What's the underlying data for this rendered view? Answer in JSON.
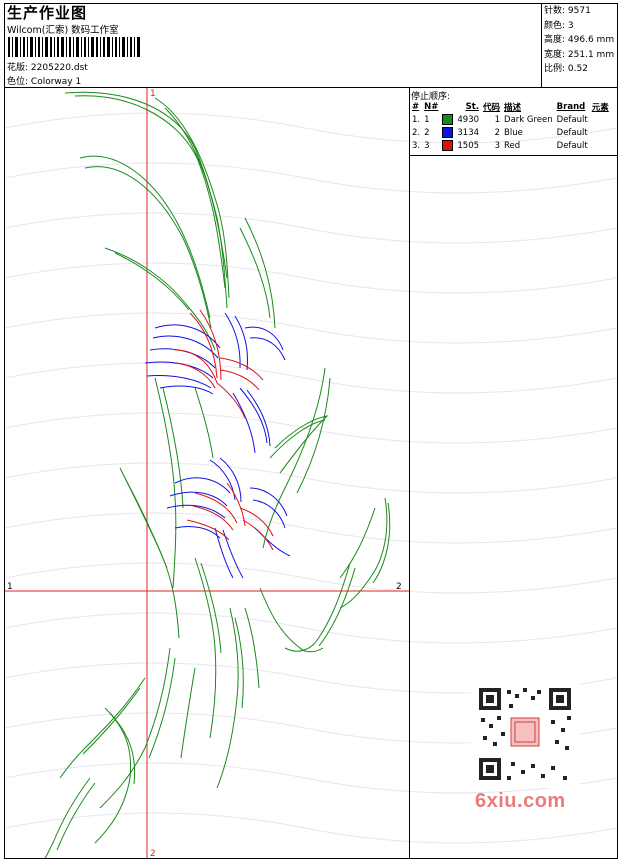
{
  "header": {
    "title": "生产作业图",
    "studio": "Wilcom(汇索) 数码工作室",
    "design_file_label": "花版:",
    "design_file": "2205220.dst",
    "colorway_label": "色位:",
    "colorway": "Colorway 1"
  },
  "stats": {
    "stitches_label": "针数:",
    "stitches": "9571",
    "colors_label": "颜色:",
    "colors": "3",
    "height_label": "高度:",
    "height": "496.6 mm",
    "width_label": "宽度:",
    "width": "251.1 mm",
    "scale_label": "比例:",
    "scale": "0.52"
  },
  "stop_sequence": {
    "title": "停止顺序:",
    "headers": [
      "#",
      "N#",
      "St.",
      "代码",
      "描述",
      "Brand",
      "元素"
    ],
    "rows": [
      {
        "idx": "1.",
        "n": "1",
        "color": "#1a8a1a",
        "stitches": "4930",
        "code": "1",
        "desc": "Dark Green",
        "brand": "Default",
        "elem": ""
      },
      {
        "idx": "2.",
        "n": "2",
        "color": "#1010e0",
        "stitches": "3134",
        "code": "2",
        "desc": "Blue",
        "brand": "Default",
        "elem": ""
      },
      {
        "idx": "3.",
        "n": "3",
        "color": "#e01010",
        "stitches": "1505",
        "code": "3",
        "desc": "Red",
        "brand": "Default",
        "elem": ""
      }
    ]
  },
  "axes": {
    "top_label": "1",
    "bottom_label": "2",
    "left_label": "1",
    "right_label": "2"
  },
  "watermark": "6xiu.com",
  "colors": {
    "green": "#1a8a1a",
    "blue": "#1010e0",
    "red": "#e01010",
    "axis": "#e02020"
  }
}
